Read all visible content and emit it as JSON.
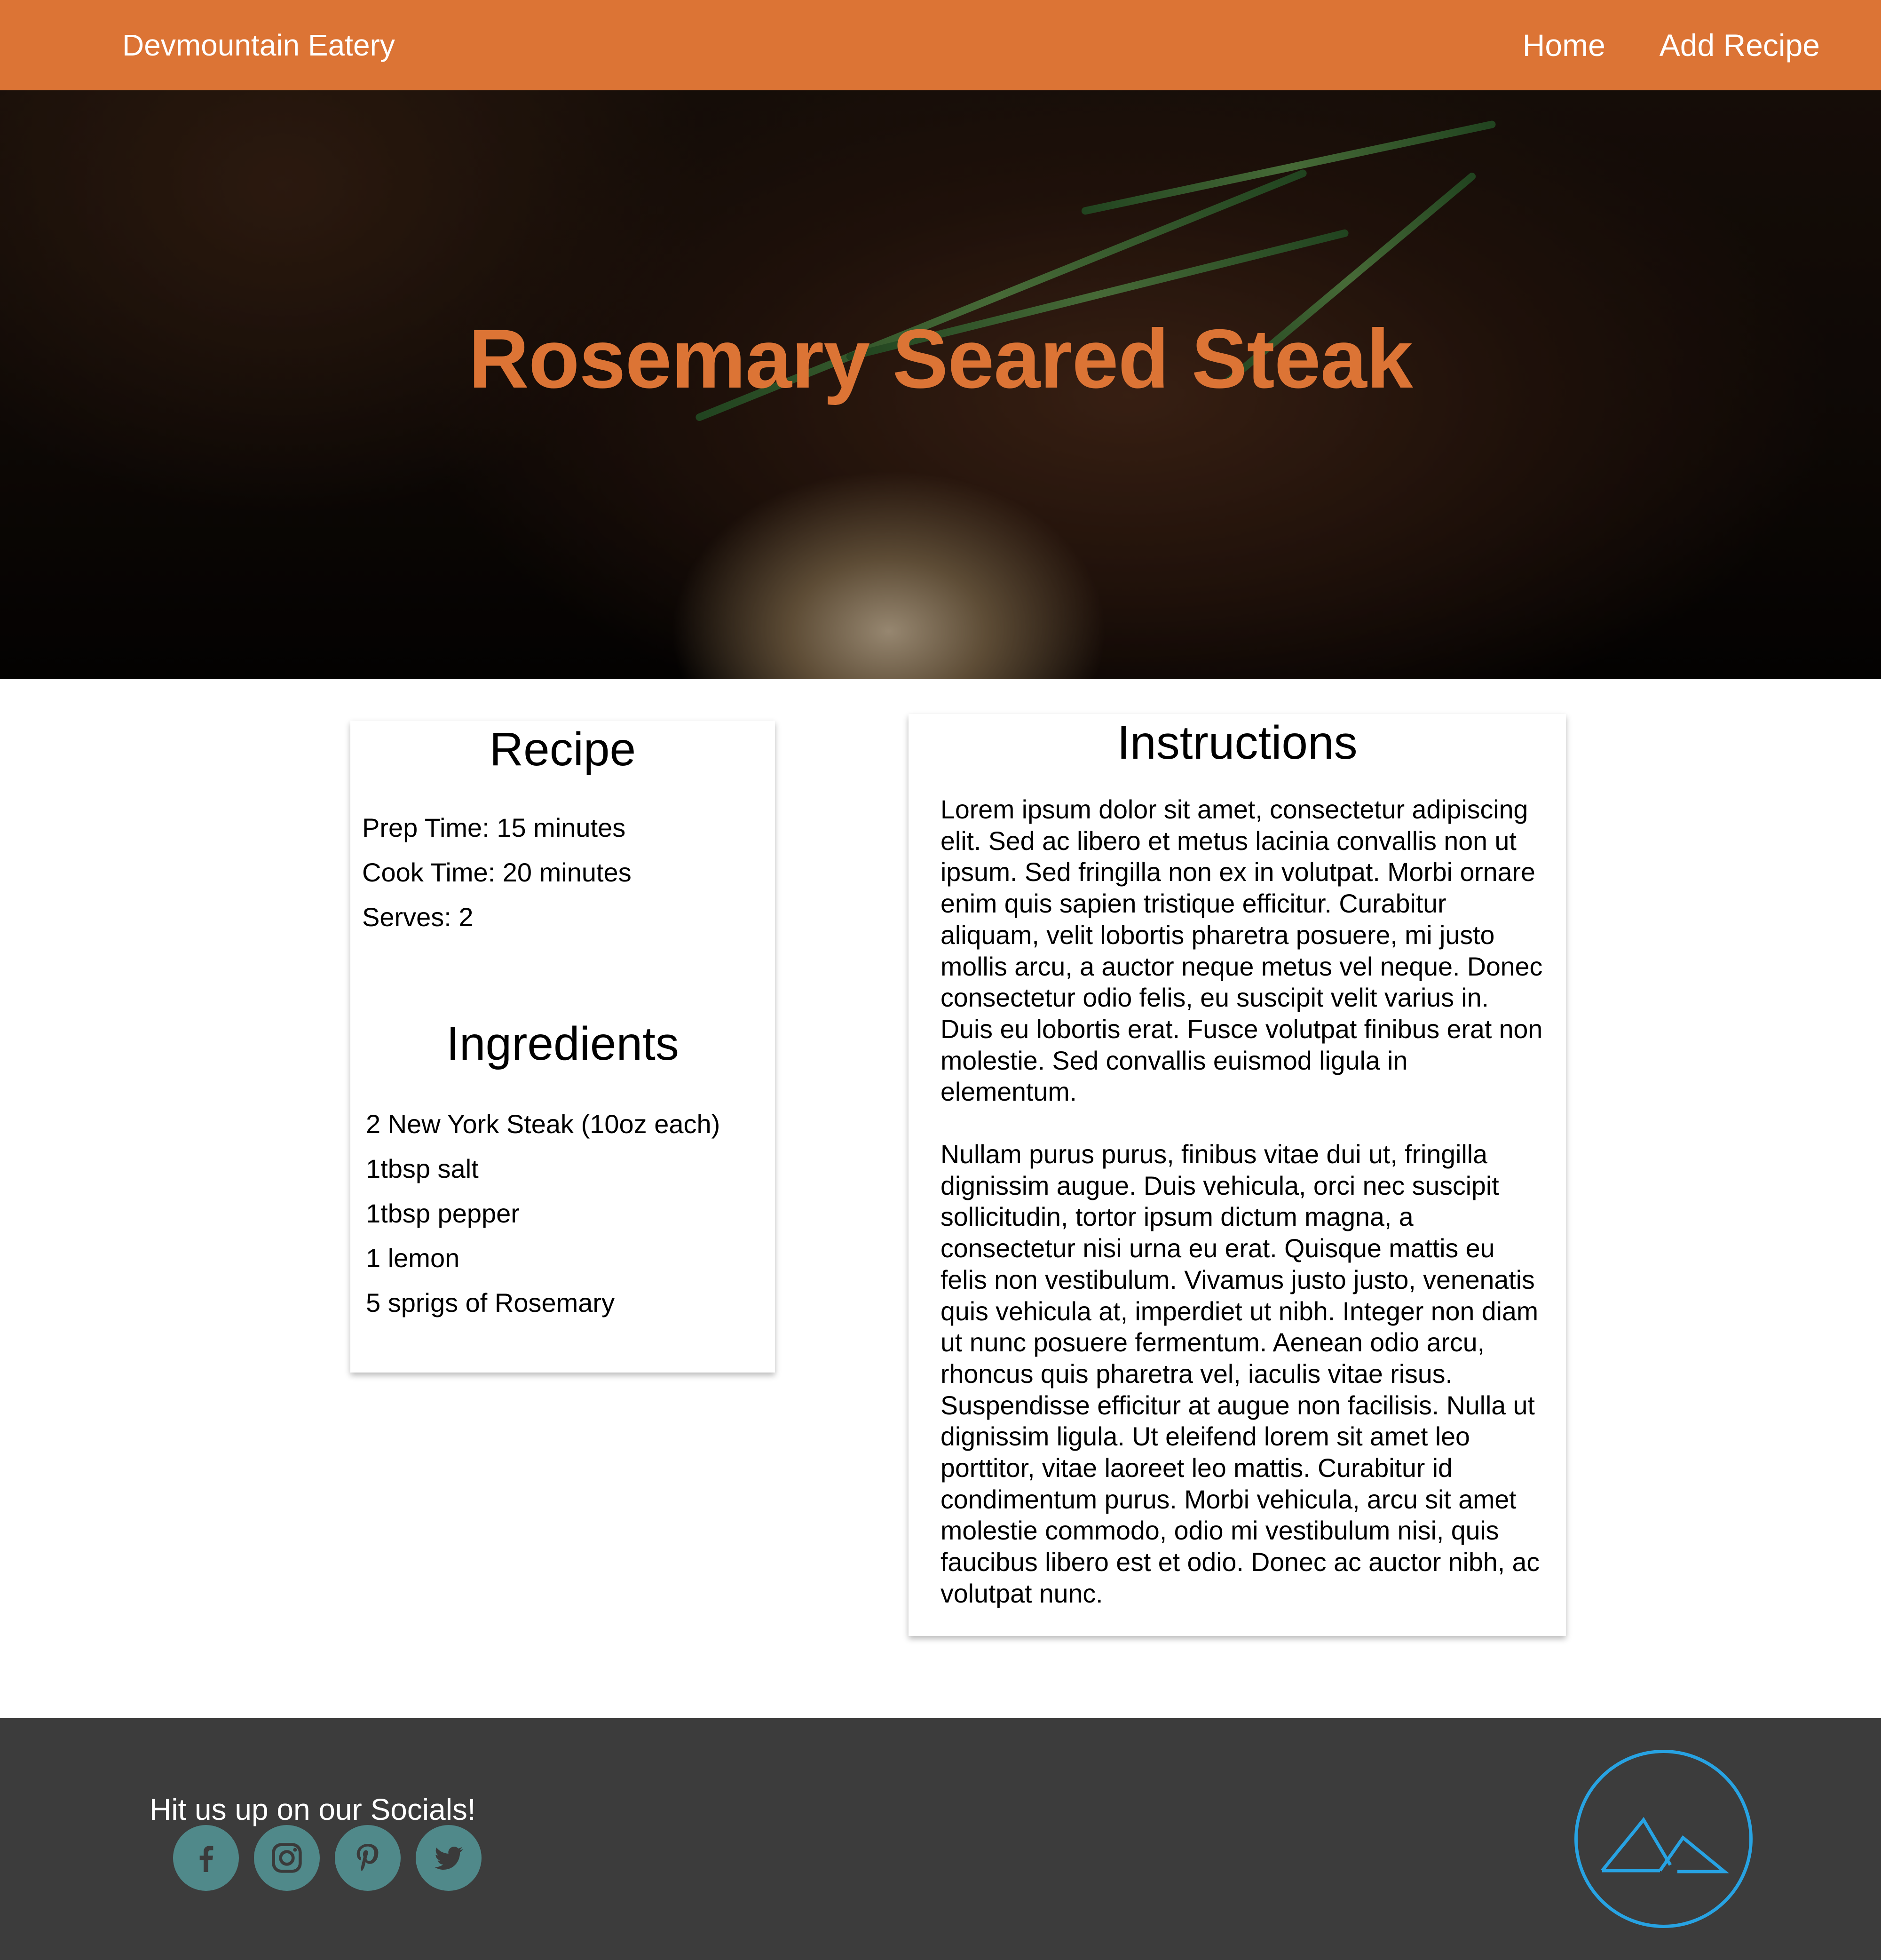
{
  "header": {
    "brand": "Devmountain Eatery",
    "nav": [
      "Home",
      "Add Recipe"
    ]
  },
  "hero": {
    "title": "Rosemary Seared Steak"
  },
  "recipe": {
    "heading": "Recipe",
    "info": [
      "Prep Time: 15 minutes",
      "Cook Time: 20 minutes",
      "Serves: 2"
    ],
    "ingredients_heading": "Ingredients",
    "ingredients": [
      "2 New York Steak (10oz each)",
      "1tbsp salt",
      "1tbsp pepper",
      "1 lemon",
      "5 sprigs of Rosemary"
    ]
  },
  "instructions": {
    "heading": "Instructions",
    "paragraphs": [
      "Lorem ipsum dolor sit amet, consectetur adipiscing elit. Sed ac libero et metus lacinia convallis non ut ipsum. Sed fringilla non ex in volutpat. Morbi ornare enim quis sapien tristique efficitur. Curabitur aliquam, velit lobortis pharetra posuere, mi justo mollis arcu, a auctor neque metus vel neque. Donec consectetur odio felis, eu suscipit velit varius in. Duis eu lobortis erat. Fusce volutpat finibus erat non molestie. Sed convallis euismod ligula in elementum.",
      "Nullam purus purus, finibus vitae dui ut, fringilla dignissim augue. Duis vehicula, orci nec suscipit sollicitudin, tortor ipsum dictum magna, a consectetur nisi urna eu erat. Quisque mattis eu felis non vestibulum. Vivamus justo justo, venenatis quis vehicula at, imperdiet ut nibh. Integer non diam ut nunc posuere fermentum. Aenean odio arcu, rhoncus quis pharetra vel, iaculis vitae risus. Suspendisse efficitur at augue non facilisis. Nulla ut dignissim ligula. Ut eleifend lorem sit amet leo porttitor, vitae laoreet leo mattis. Curabitur id condimentum purus. Morbi vehicula, arcu sit amet molestie commodo, odio mi vestibulum nisi, quis faucibus libero est et odio. Donec ac auctor nibh, ac volutpat nunc."
    ]
  },
  "footer": {
    "social_title": "Hit us up on our Socials!",
    "socials": [
      "facebook-icon",
      "instagram-icon",
      "pinterest-icon",
      "twitter-icon"
    ],
    "logo": "devmountain-logo-icon"
  },
  "colors": {
    "accent": "#dc7435",
    "footer_bg": "#3c3c3c",
    "social_bg": "#50898a",
    "logo_blue": "#27a3e3"
  }
}
